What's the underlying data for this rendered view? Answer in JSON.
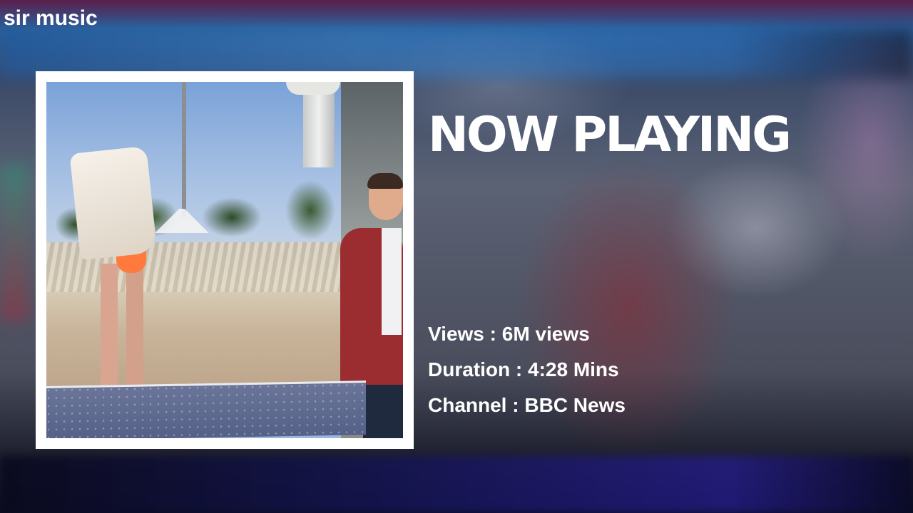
{
  "app": {
    "brand": "sir music"
  },
  "header": {
    "title": "NOW PLAYING"
  },
  "video": {
    "thumbnail_icon": "video-thumbnail",
    "views_label": "Views",
    "views_value": "6M views",
    "duration_label": "Duration",
    "duration_value": "4:28 Mins",
    "channel_label": "Channel",
    "channel_value": "BBC News"
  },
  "colors": {
    "text": "#ffffff",
    "frame": "#ffffff"
  }
}
